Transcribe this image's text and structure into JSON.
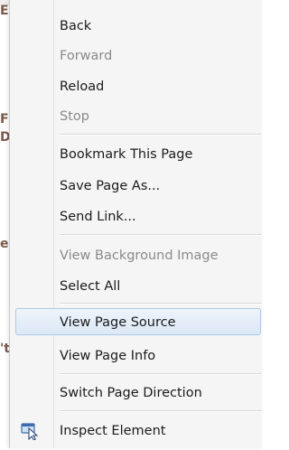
{
  "background_fragments": [
    "E",
    "Fi",
    "D",
    "e",
    "'t"
  ],
  "menu": {
    "items": [
      {
        "label": "Back",
        "disabled": false
      },
      {
        "label": "Forward",
        "disabled": true
      },
      {
        "label": "Reload",
        "disabled": false
      },
      {
        "label": "Stop",
        "disabled": true
      },
      {
        "label": "Bookmark This Page",
        "disabled": false
      },
      {
        "label": "Save Page As...",
        "disabled": false
      },
      {
        "label": "Send Link...",
        "disabled": false
      },
      {
        "label": "View Background Image",
        "disabled": true
      },
      {
        "label": "Select All",
        "disabled": false
      },
      {
        "label": "View Page Source",
        "disabled": false,
        "highlighted": true
      },
      {
        "label": "View Page Info",
        "disabled": false
      },
      {
        "label": "Switch Page Direction",
        "disabled": false
      },
      {
        "label": "Inspect Element",
        "disabled": false,
        "icon": "inspect-cursor-icon"
      }
    ]
  },
  "colors": {
    "menu_background": "#f5f5f5",
    "highlight_border": "#aec9e8",
    "disabled_text": "#8a8a8a"
  }
}
